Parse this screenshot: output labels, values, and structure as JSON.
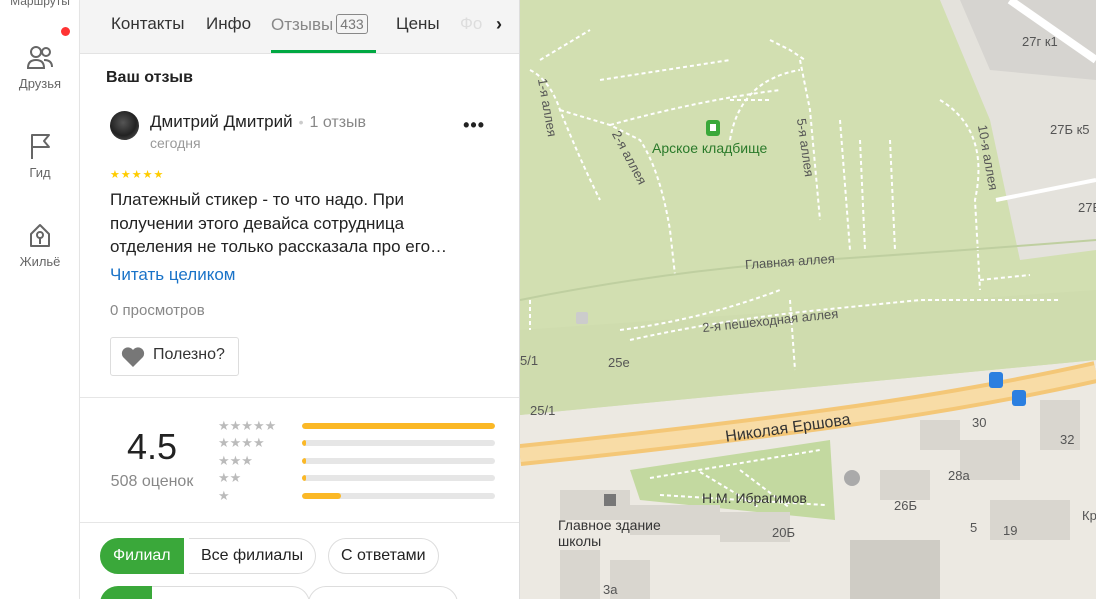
{
  "rail": {
    "cut_label": "Маршруты",
    "items": [
      {
        "label": "Друзья",
        "icon": "friends-icon"
      },
      {
        "label": "Гид",
        "icon": "flag-icon"
      },
      {
        "label": "Жильё",
        "icon": "house-key-icon"
      }
    ]
  },
  "tabs": {
    "contacts": "Контакты",
    "info": "Инфо",
    "reviews": "Отзывы",
    "reviews_count": "433",
    "prices": "Цены",
    "photos": "Фо"
  },
  "my_review": {
    "title": "Ваш отзыв",
    "author": "Дмитрий Дмитрий",
    "author_reviews": "1 отзыв",
    "date": "сегодня",
    "rating": 5,
    "stars": "★★★★★",
    "text": "Платежный стикер - то что надо. При получении этого девайса сотрудница отделения не только рассказала про его…",
    "read_more": "Читать целиком",
    "views": "0 просмотров",
    "useful": "Полезно?"
  },
  "summary": {
    "score": "4.5",
    "count": "508 оценок",
    "distribution": [
      {
        "stars": "★★★★★",
        "share": 1.0
      },
      {
        "stars": "★★★★",
        "share": 0.02
      },
      {
        "stars": "★★★",
        "share": 0.02
      },
      {
        "stars": "★★",
        "share": 0.02
      },
      {
        "stars": "★",
        "share": 0.2
      }
    ]
  },
  "filters": {
    "branch": "Филиал",
    "all_branches": "Все филиалы",
    "with_answers": "С ответами"
  },
  "map": {
    "poi": "Арское кладбище",
    "roads": {
      "main_alley": "Главная аллея",
      "second_ped": "2-я пешеходная аллея",
      "ershova": "Николая Ершова",
      "alley1": "1-я аллея",
      "alley2": "2-я аллея",
      "alley5": "5-я аллея",
      "alley10": "10-я аллея"
    },
    "places": {
      "ibragimov": "Н.М. Ибрагимов",
      "school": "Главное здание школы"
    },
    "numbers": [
      "27г к1",
      "27Б к5",
      "27В",
      "25е",
      "25/1",
      "5/1",
      "30",
      "32",
      "28а",
      "26Б",
      "20Б",
      "5",
      "19",
      "3а",
      "Кр"
    ]
  },
  "colors": {
    "accent": "#00a842",
    "link": "#1a73c8",
    "star": "#fbb826"
  }
}
